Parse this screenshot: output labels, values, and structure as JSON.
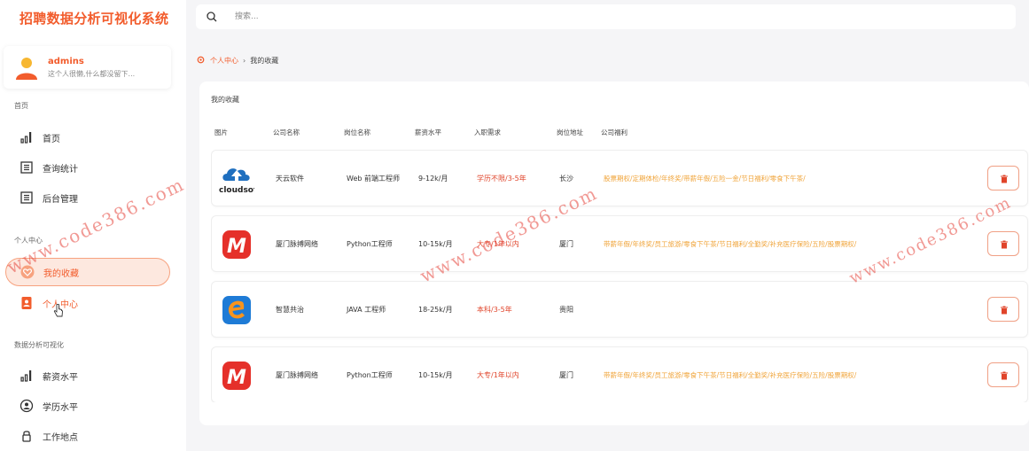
{
  "app": {
    "title": "招聘数据分析可视化系统"
  },
  "user": {
    "name": "admins",
    "bio": "这个人很懒,什么都没留下..."
  },
  "sidebar": {
    "sections": [
      {
        "label": "首页"
      },
      {
        "label": "个人中心"
      },
      {
        "label": "数据分析可视化"
      }
    ],
    "items": [
      {
        "label": "首页",
        "icon": "bar-chart-icon"
      },
      {
        "label": "查询统计",
        "icon": "list-doc-icon"
      },
      {
        "label": "后台管理",
        "icon": "list-doc-icon"
      },
      {
        "label": "我的收藏",
        "icon": "heart-icon",
        "active": true
      },
      {
        "label": "个人中心",
        "icon": "user-card-icon"
      },
      {
        "label": "薪资水平",
        "icon": "bar-chart-icon"
      },
      {
        "label": "学历水平",
        "icon": "graduate-icon"
      },
      {
        "label": "工作地点",
        "icon": "lock-icon"
      }
    ]
  },
  "search": {
    "placeholder": "搜索..."
  },
  "breadcrumb": {
    "parent": "个人中心",
    "separator": "›",
    "current": "我的收藏"
  },
  "panel": {
    "title": "我的收藏",
    "headers": [
      "图片",
      "公司名称",
      "岗位名称",
      "薪资水平",
      "入职需求",
      "岗位地址",
      "公司福利"
    ],
    "rows": [
      {
        "logo": "cloudsoft-logo-icon",
        "logo_text": "cloudsof",
        "company": "天云软件",
        "position": "Web 前端工程师",
        "salary": "9-12k/月",
        "requirement": "学历不限/3-5年",
        "location": "长沙",
        "welfare": "股票期权/定期体检/年终奖/带薪年假/五险一金/节日福利/零食下午茶/"
      },
      {
        "logo": "m-logo-icon",
        "logo_text": "M",
        "company": "厦门脉搏网络",
        "position": "Python工程师",
        "salary": "10-15k/月",
        "requirement": "大专/1年以内",
        "location": "厦门",
        "welfare": "带薪年假/年终奖/员工旅游/零食下午茶/节日福利/全勤奖/补充医疗保险/五险/股票期权/"
      },
      {
        "logo": "e-logo-icon",
        "logo_text": "e",
        "company": "智慧共治",
        "position": "JAVA 工程师",
        "salary": "18-25k/月",
        "requirement": "本科/3-5年",
        "location": "贵阳",
        "welfare": ""
      },
      {
        "logo": "m-logo-icon",
        "logo_text": "M",
        "company": "厦门脉搏网络",
        "position": "Python工程师",
        "salary": "10-15k/月",
        "requirement": "大专/1年以内",
        "location": "厦门",
        "welfare": "带薪年假/年终奖/员工旅游/零食下午茶/节日福利/全勤奖/补充医疗保险/五险/股票期权/"
      }
    ]
  },
  "watermark": {
    "text": "www.code386.com"
  },
  "colors": {
    "accent": "#f25c2c",
    "welfare": "#f0a43a",
    "requirement": "#e0442a"
  }
}
